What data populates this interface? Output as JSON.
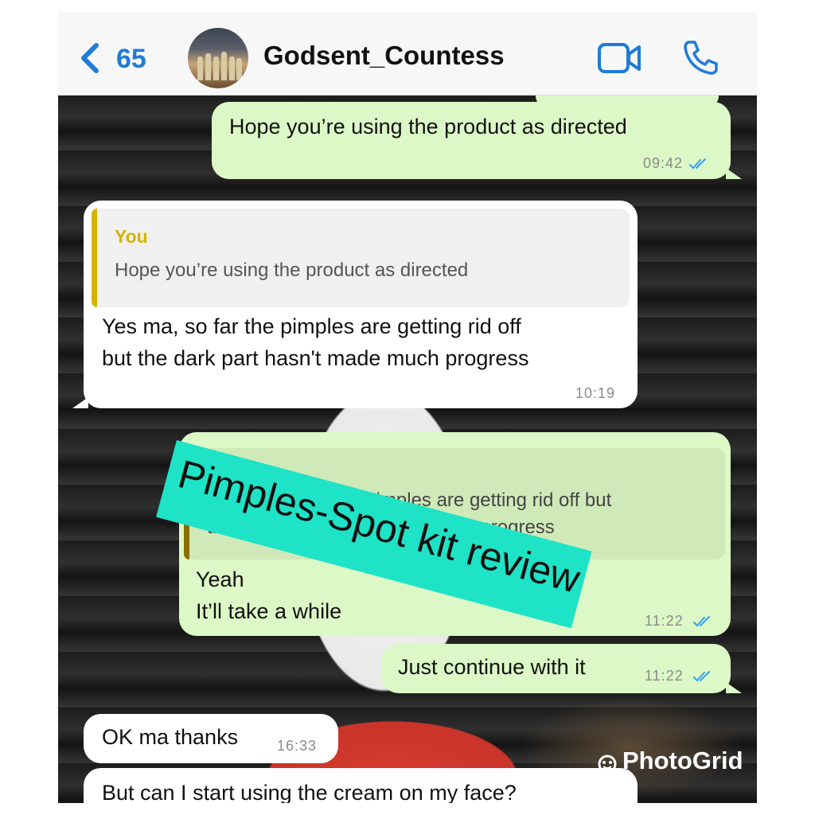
{
  "header": {
    "back_count": "65",
    "contact_name": "Godsent_Countess"
  },
  "messages": {
    "m1": {
      "text": "Hope you’re using the product as directed",
      "time": "09:42"
    },
    "m2": {
      "quote_author": "You",
      "quote_text": "Hope you’re using the product as directed",
      "line1": "Yes ma, so far the pimples are getting rid off",
      "line2": "but the dark part hasn't made much progress",
      "time": "10:19"
    },
    "m3": {
      "quote_line1": "Yes ma, so far the pimples are getting rid off but",
      "quote_line2": "the dark part hasn't made much progress",
      "line1": "Yeah",
      "line2": "It’ll take a while",
      "time": "11:22"
    },
    "m4": {
      "text": "Just continue with it",
      "time": "11:22"
    },
    "m5": {
      "text": "OK ma thanks",
      "time": "16:33"
    },
    "m6": {
      "text": "But can I start using the cream on my face?"
    }
  },
  "overlay": {
    "banner_text": "Pimples-Spot kit review",
    "watermark": "PhotoGrid"
  },
  "colors": {
    "outgoing_bubble": "#dcf8c6",
    "incoming_bubble": "#ffffff",
    "accent_blue": "#1f7bd9",
    "quote_author": "#d4b400",
    "banner": "#1ee3c6"
  },
  "icons": [
    "chevron-left-icon",
    "video-camera-icon",
    "phone-icon",
    "read-ticks-icon",
    "photogrid-logo-icon"
  ]
}
